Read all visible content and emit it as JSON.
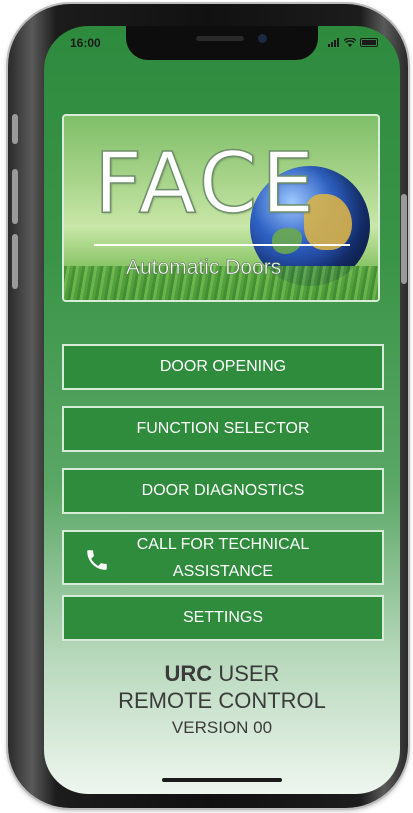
{
  "status_bar": {
    "time": "16:00"
  },
  "logo": {
    "brand": "FACE",
    "tagline": "Automatic Doors"
  },
  "menu": {
    "door_opening": "DOOR OPENING",
    "function_selector": "FUNCTION SELECTOR",
    "door_diagnostics": "DOOR DIAGNOSTICS",
    "call_assistance_line1": "CALL FOR TECHNICAL",
    "call_assistance_line2": "ASSISTANCE",
    "settings": "SETTINGS"
  },
  "footer": {
    "app_name_bold": "URC",
    "app_name_rest": " USER",
    "app_subtitle": "REMOTE CONTROL",
    "version": "VERSION 00"
  },
  "colors": {
    "button_green": "#2f8c3c",
    "background_green": "#3a9447",
    "button_border": "#d6ebd8"
  },
  "icons": {
    "call_icon": "phone-icon"
  }
}
